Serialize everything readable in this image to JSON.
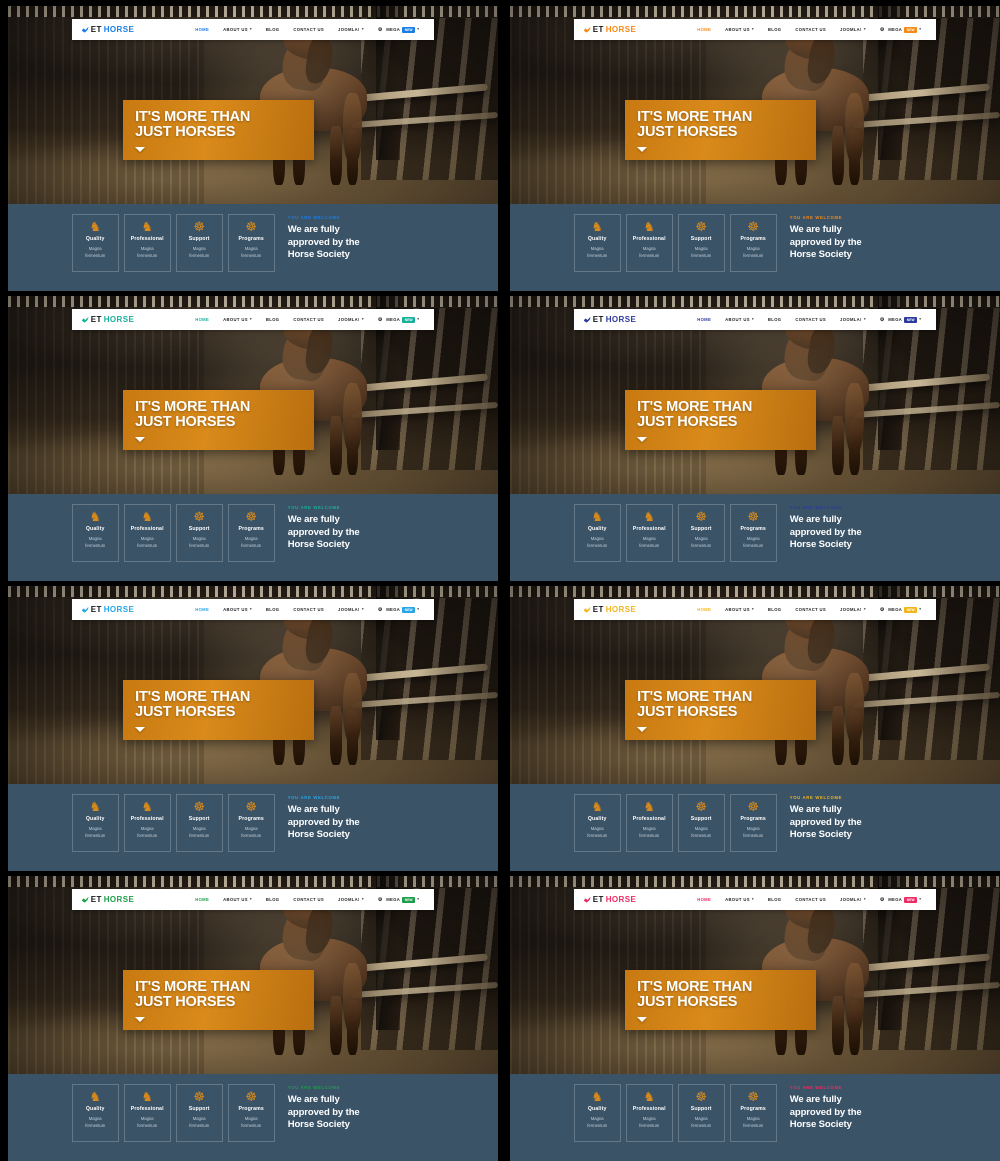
{
  "page": {
    "title": "ET HORSE template color variations",
    "panel_count": 8,
    "columns": 2,
    "rows": 4
  },
  "common": {
    "logo": {
      "icon": "horse-mark-icon",
      "primary": "ET",
      "secondary": "HORSE"
    },
    "menu": [
      {
        "label": "HOME",
        "active": true,
        "caret": false
      },
      {
        "label": "ABOUT US",
        "active": false,
        "caret": true
      },
      {
        "label": "BLOG",
        "active": false,
        "caret": false
      },
      {
        "label": "CONTACT US",
        "active": false,
        "caret": false
      },
      {
        "label": "JOOMLA!",
        "active": false,
        "caret": true
      },
      {
        "label": "MEGA",
        "active": false,
        "caret": true,
        "gear": true,
        "badge": "NEW"
      }
    ],
    "hero": {
      "headline_line1": "IT'S MORE THAN",
      "headline_line2": "JUST HORSES",
      "scroll_arrow": "arrow-down-icon",
      "box_color": "#c87a12"
    },
    "features": [
      {
        "icon": "horse-rider-icon",
        "glyph": "♞",
        "title": "Quality",
        "desc_line1": "Magna",
        "desc_line2": "fermentum"
      },
      {
        "icon": "horse-rider-icon",
        "glyph": "♞",
        "title": "Professional",
        "desc_line1": "Magna",
        "desc_line2": "fermentum"
      },
      {
        "icon": "horseshoe-icon",
        "glyph": "☸",
        "title": "Support",
        "desc_line1": "Magna",
        "desc_line2": "fermentum"
      },
      {
        "icon": "horseshoe-icon",
        "glyph": "☸",
        "title": "Programs",
        "desc_line1": "Magna",
        "desc_line2": "fermentum"
      }
    ],
    "welcome": {
      "eyebrow": "YOU ARE WELCOME",
      "title_line1": "We are fully",
      "title_line2": "approved by the",
      "title_line3": "Horse Society"
    },
    "strip_bg": "#3a5367"
  },
  "variants": [
    {
      "id": "variant-blue",
      "name": "Blue",
      "accent": "#1a7ee8"
    },
    {
      "id": "variant-orange",
      "name": "Orange",
      "accent": "#f58a14"
    },
    {
      "id": "variant-teal",
      "name": "Teal",
      "accent": "#17b09b"
    },
    {
      "id": "variant-navy",
      "name": "Navy",
      "accent": "#2b3a9e"
    },
    {
      "id": "variant-cyan",
      "name": "Cyan",
      "accent": "#27a6e8"
    },
    {
      "id": "variant-yellow",
      "name": "Yellow",
      "accent": "#f2b61d"
    },
    {
      "id": "variant-green",
      "name": "Green",
      "accent": "#1f9e4a"
    },
    {
      "id": "variant-pink",
      "name": "Pink",
      "accent": "#ef2b63"
    }
  ]
}
